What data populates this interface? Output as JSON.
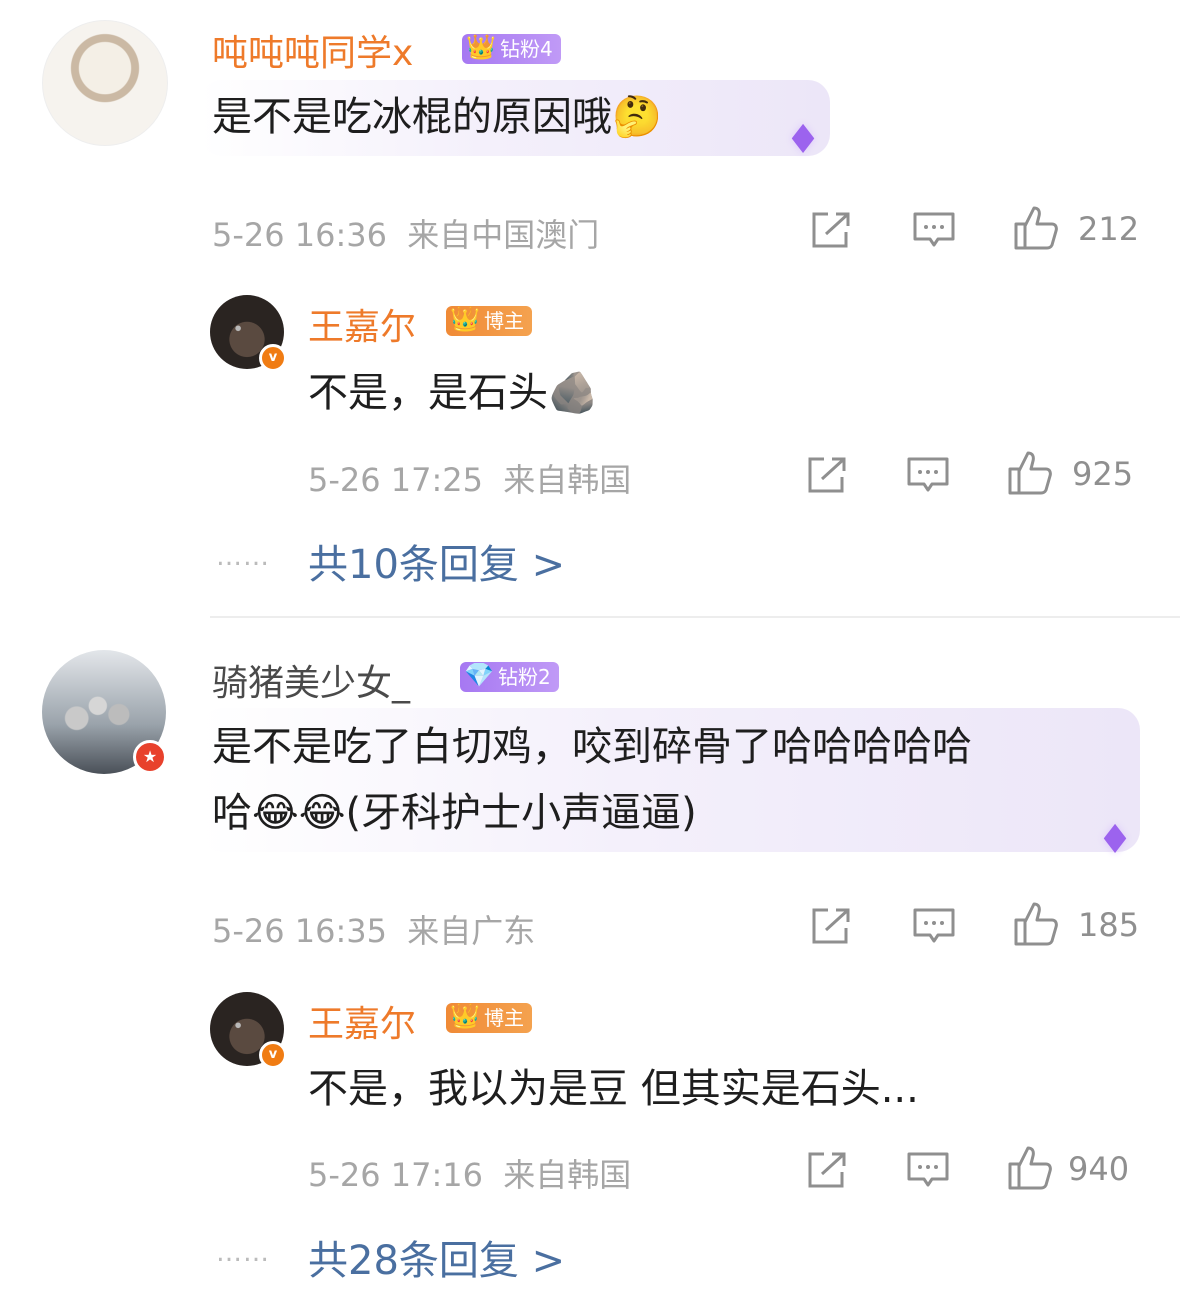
{
  "comments": [
    {
      "author": "吨吨吨同学x",
      "fan_badge": "钻粉4",
      "text": "是不是吃冰棍的原因哦",
      "emoji": "🤔",
      "time": "5-26 16:36",
      "location": "来自中国澳门",
      "likes": "212",
      "reply": {
        "author": "王嘉尔",
        "role_badge": "博主",
        "text": "不是，是石头",
        "emoji": "🪨",
        "time": "5-26 17:25",
        "location": "来自韩国",
        "likes": "925"
      },
      "replies_link": "共10条回复 >",
      "replies_dots": "……"
    },
    {
      "author": "骑猪美少女_",
      "fan_badge": "钻粉2",
      "text_line1": "是不是吃了白切鸡，咬到碎骨了哈哈哈哈哈",
      "text_line2_prefix": "哈",
      "text_line2_emoji": "😂😂",
      "text_line2_suffix": "(牙科护士小声逼逼)",
      "time": "5-26 16:35",
      "location": "来自广东",
      "likes": "185",
      "reply": {
        "author": "王嘉尔",
        "role_badge": "博主",
        "text": "不是，我以为是豆 但其实是石头...",
        "time": "5-26 17:16",
        "location": "来自韩国",
        "likes": "940"
      },
      "replies_link": "共28条回复 >",
      "replies_dots": "……"
    }
  ],
  "icons": {
    "share": "share-icon",
    "comment": "comment-icon",
    "like": "thumbs-up-icon",
    "verified": "verified-v-icon",
    "crown": "crown-icon",
    "diamond": "diamond-icon"
  },
  "colors": {
    "name_orange": "#ee7a2a",
    "link_blue": "#4a6fa0",
    "fan_purple": "#a678f2",
    "meta_gray": "#a6a6a6"
  }
}
